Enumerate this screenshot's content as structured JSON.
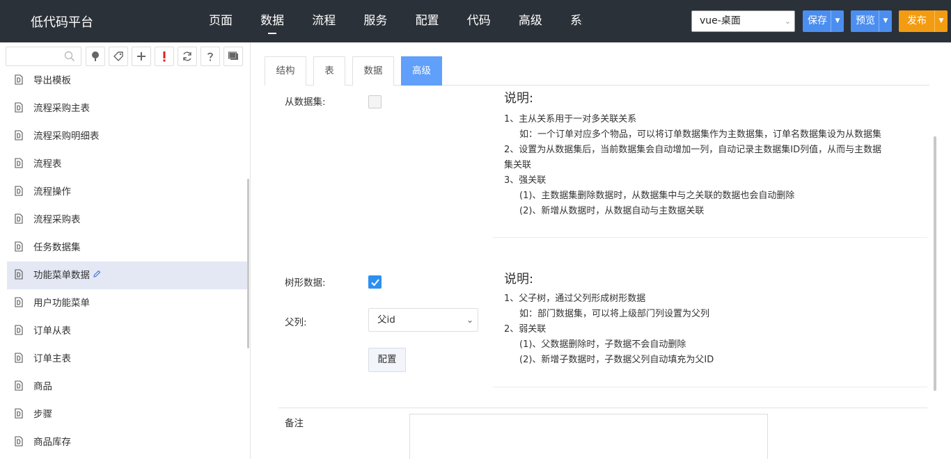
{
  "app": {
    "title": "低代码平台",
    "nav": [
      "页面",
      "数据",
      "流程",
      "服务",
      "配置",
      "代码",
      "高级",
      "系统"
    ],
    "active_nav": "数据",
    "platform_value": "vue-桌面",
    "save": "保存",
    "preview": "预览",
    "publish": "发布"
  },
  "sidebar": {
    "search_placeholder": "",
    "items": [
      "导出模板",
      "流程采购主表",
      "流程采购明细表",
      "流程表",
      "流程操作",
      "流程采购表",
      "任务数据集",
      "功能菜单数据",
      "用户功能菜单",
      "订单从表",
      "订单主表",
      "商品",
      "步骤",
      "商品库存"
    ],
    "selected_item": "功能菜单数据"
  },
  "tabs": [
    "结构",
    "表",
    "数据",
    "高级"
  ],
  "active_tab": "高级",
  "form": {
    "from_dataset_label": "从数据集:",
    "from_dataset_checked": false,
    "tree_data_label": "树形数据:",
    "tree_data_checked": true,
    "parent_col_label": "父列:",
    "parent_col_value": "父id",
    "config_button": "配置",
    "remark_label": "备注"
  },
  "desc1": {
    "title": "说明:",
    "lines": [
      "1、主从关系用于一对多关联关系",
      "如：一个订单对应多个物品，可以将订单数据集作为主数据集，订单名数据集设为从数据集",
      "2、设置为从数据集后，当前数据集会自动增加一列，自动记录主数据集ID列值，从而与主数据",
      "集关联",
      "3、强关联",
      "(1)、主数据集删除数据时，从数据集中与之关联的数据也会自动删除",
      "(2)、新增从数据时，从数据自动与主数据关联"
    ]
  },
  "desc2": {
    "title": "说明:",
    "lines": [
      "1、父子树，通过父列形成树形数据",
      "如：部门数据集，可以将上级部门列设置为父列",
      "2、弱关联",
      "(1)、父数据删除时，子数据不会自动删除",
      "(2)、新增子数据时，子数据父列自动填充为父ID"
    ]
  },
  "colors": {
    "topbar": "#2b3138",
    "primary": "#4b8ef0",
    "publish": "#f39c12",
    "active_tab": "#609ffa",
    "selected_row": "#e3e8f4"
  }
}
